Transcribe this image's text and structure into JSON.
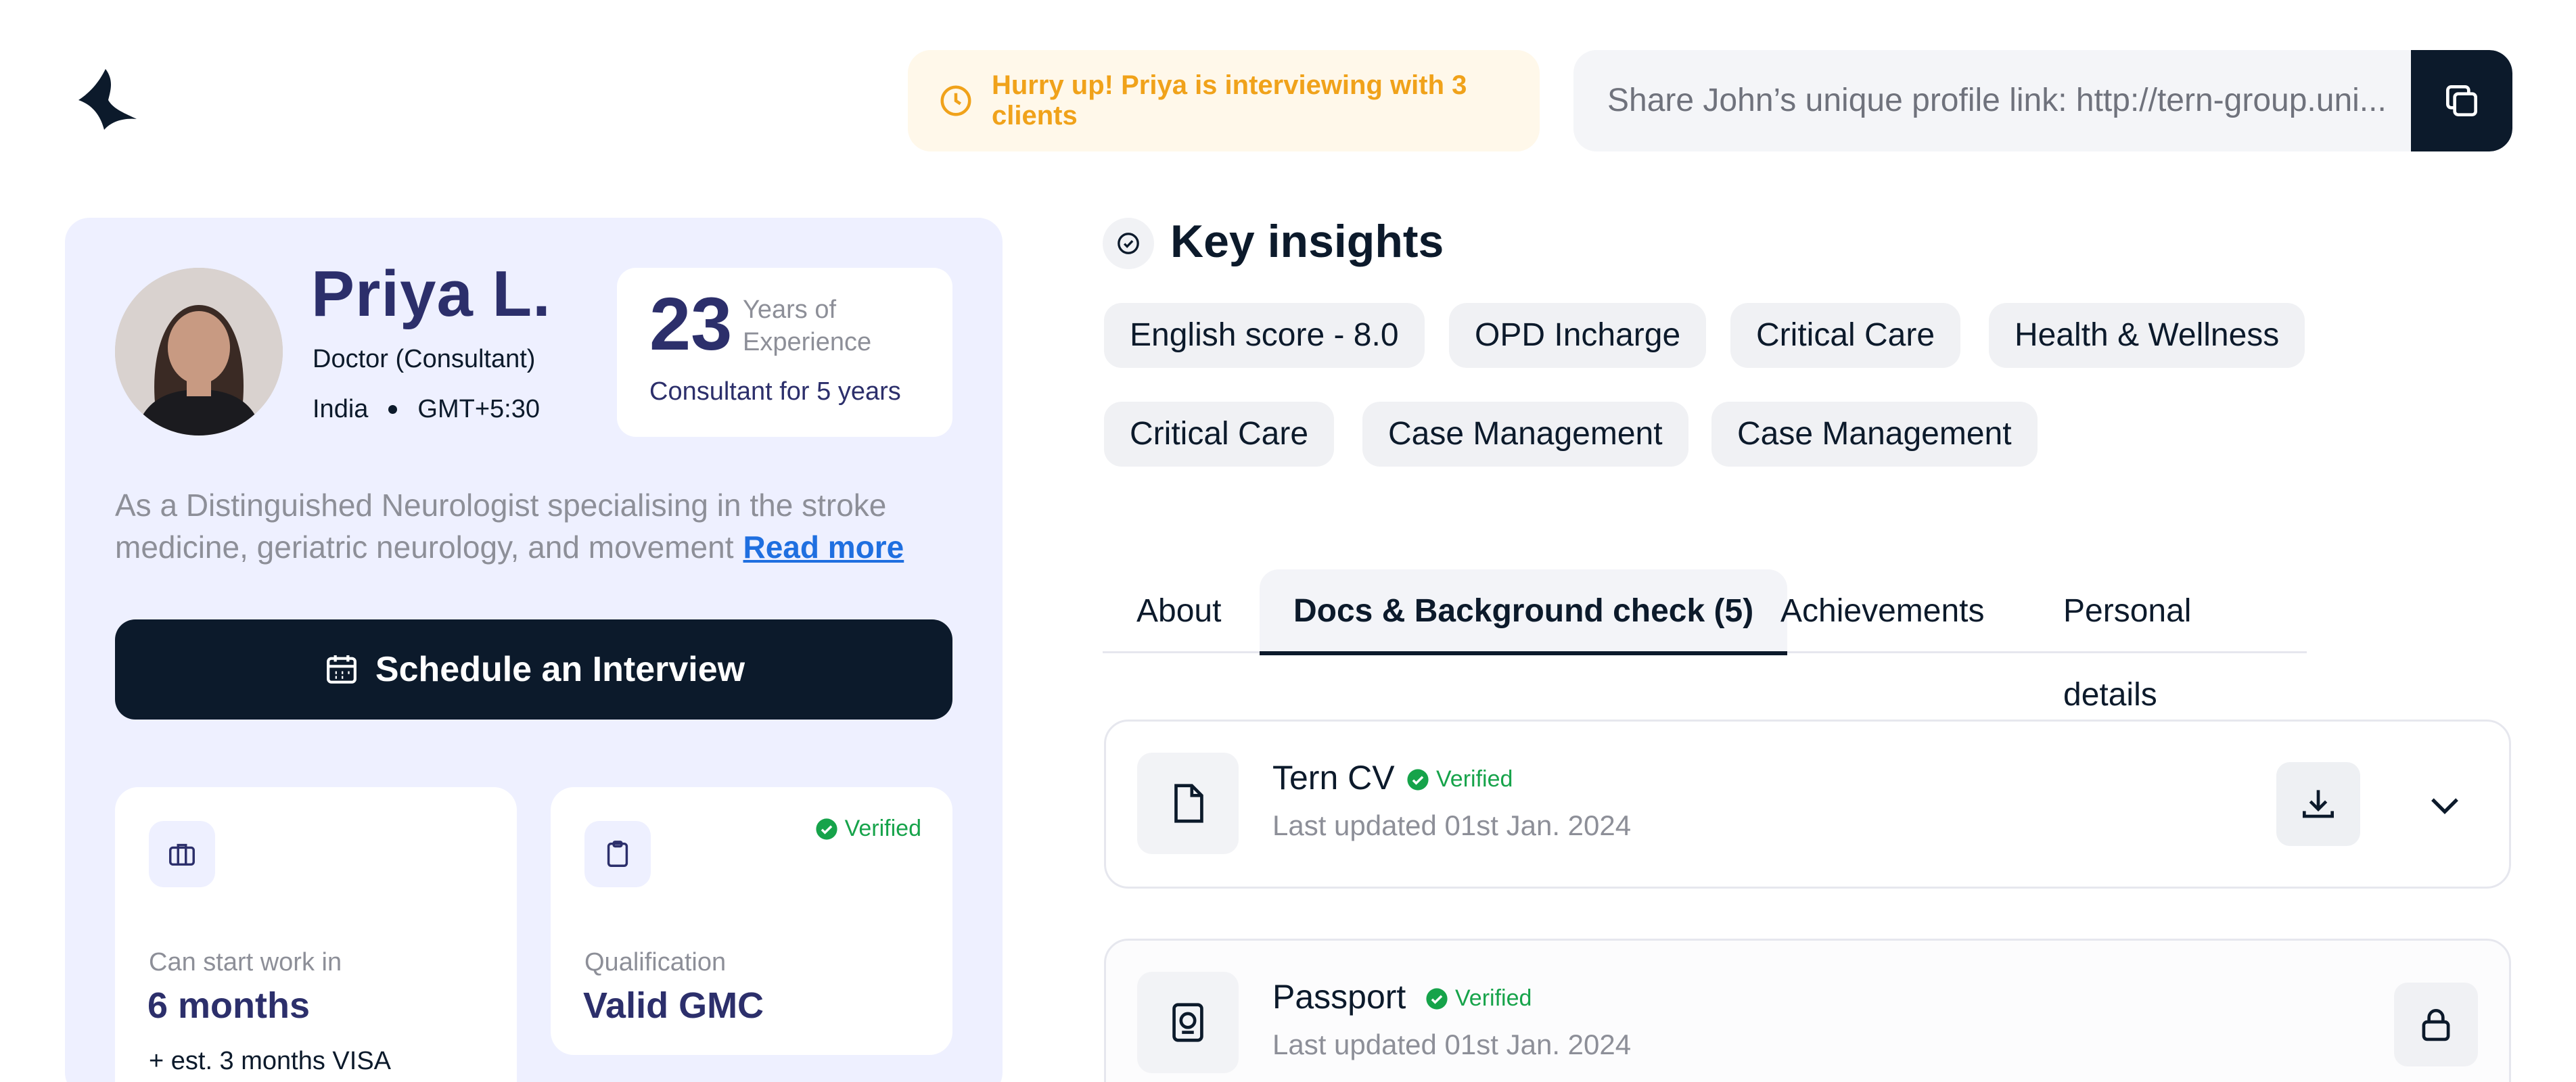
{
  "header": {
    "urgency_text": "Hurry up! Priya is interviewing with 3 clients",
    "share_text": "Share John’s unique profile link: http://tern-group.uni..."
  },
  "profile": {
    "name": "Priya L.",
    "role": "Doctor (Consultant)",
    "country": "India",
    "timezone": "GMT+5:30",
    "experience_years": "23",
    "experience_label": "Years of Experience",
    "experience_detail": "Consultant for 5 years",
    "bio": "As a Distinguished Neurologist specialising in the stroke medicine, geriatric neurology, and movement",
    "read_more": "Read more",
    "schedule_label": "Schedule an Interview",
    "start_work": {
      "label": "Can start work in",
      "value": "6 months",
      "note": "+ est. 3 months VISA"
    },
    "qualification": {
      "label": "Qualification",
      "value": "Valid GMC",
      "badge": "Verified"
    }
  },
  "insights": {
    "title": "Key insights",
    "chips": [
      "English score - 8.0",
      "OPD Incharge",
      "Critical Care",
      "Health & Wellness",
      "Critical Care",
      "Case Management",
      "Case Management"
    ]
  },
  "tabs": [
    {
      "label": "About",
      "active": false
    },
    {
      "label": "Docs & Background check (5)",
      "active": true
    },
    {
      "label": "Achievements",
      "active": false
    },
    {
      "label": "Personal details",
      "active": false
    }
  ],
  "documents": [
    {
      "title": "Tern CV",
      "badge": "Verified",
      "updated": "Last updated 01st Jan. 2024"
    },
    {
      "title": "Passport",
      "badge": "Verified",
      "updated": "Last updated 01st Jan. 2024"
    }
  ],
  "colors": {
    "navy": "#0c1a2b",
    "indigo": "#2c2f6b",
    "verified_green": "#16a34a",
    "urgency_amber": "#f0a21a",
    "card_lavender": "#eef0ff"
  }
}
